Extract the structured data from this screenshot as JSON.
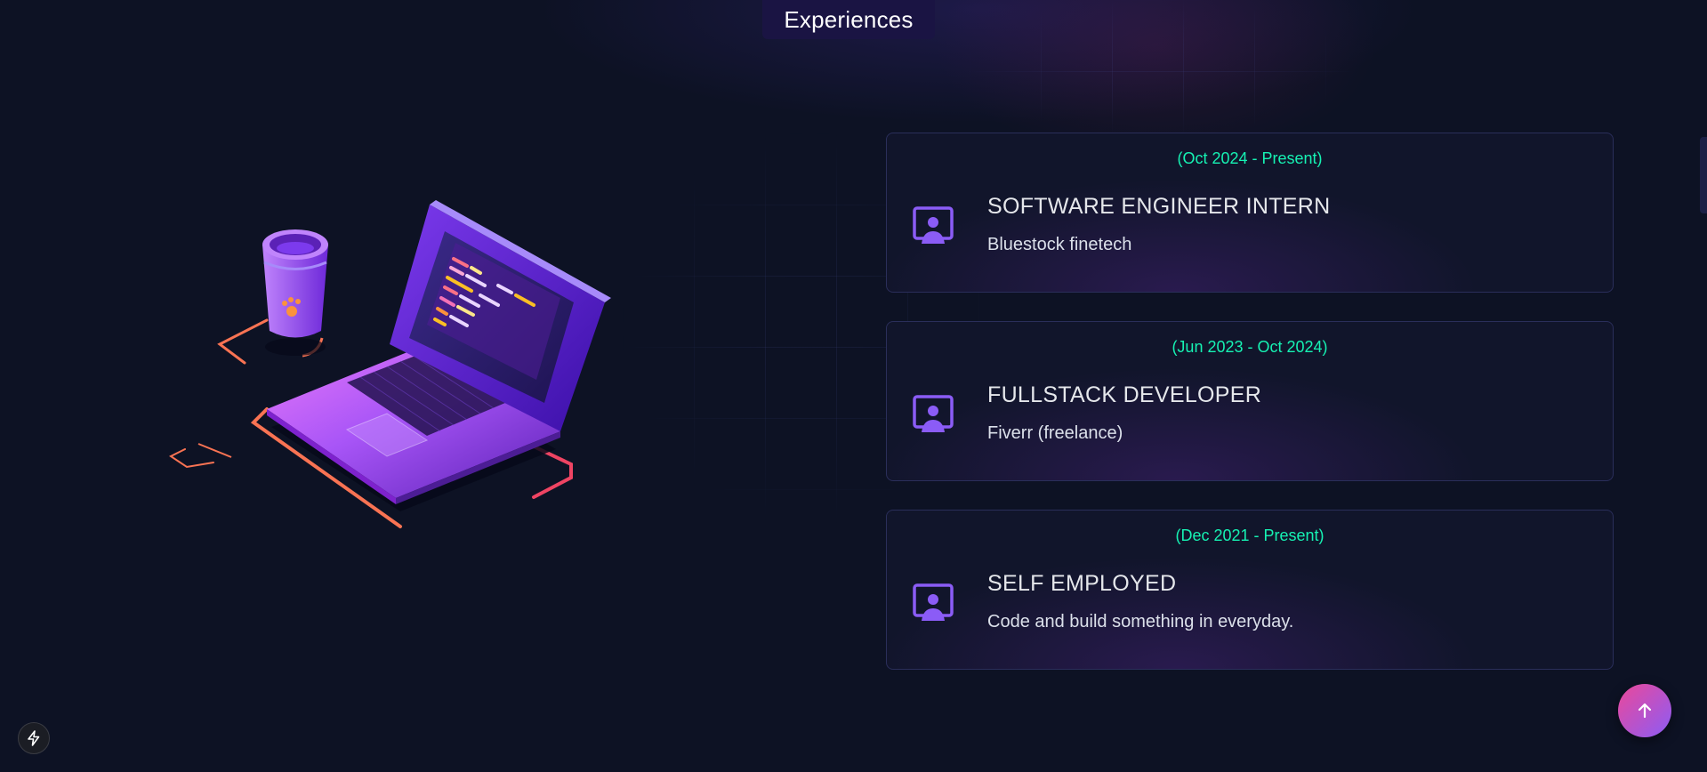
{
  "section": {
    "title": "Experiences"
  },
  "experiences": [
    {
      "date": "(Oct 2024 - Present)",
      "title": "SOFTWARE ENGINEER INTERN",
      "company": "Bluestock finetech",
      "icon": "person-presentation-icon"
    },
    {
      "date": "(Jun 2023 - Oct 2024)",
      "title": "FULLSTACK DEVELOPER",
      "company": "Fiverr (freelance)",
      "icon": "person-presentation-icon"
    },
    {
      "date": "(Dec 2021 - Present)",
      "title": "SELF EMPLOYED",
      "company": "Code and build something in everyday.",
      "icon": "person-presentation-icon"
    }
  ],
  "illustration": {
    "name": "laptop-coffee-illustration"
  },
  "controls": {
    "scroll_top_icon": "arrow-up-icon",
    "bolt_icon": "lightning-bolt-icon"
  },
  "colors": {
    "background": "#0d1224",
    "accent_date": "#16f2b3",
    "accent_icon": "#8b5cf6",
    "card_border": "#2a2e5a",
    "title_bar": "#1a1443",
    "scroll_top_gradient_start": "#ec4899",
    "scroll_top_gradient_end": "#8b5cf6"
  }
}
